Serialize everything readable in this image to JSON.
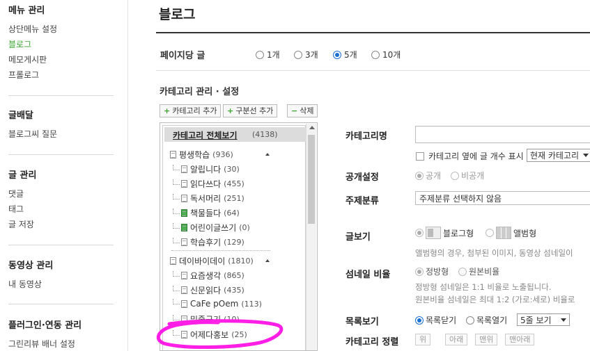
{
  "sidebar": {
    "sections": [
      {
        "title": "메뉴 관리",
        "items": [
          "상단메뉴 설정",
          "블로그",
          "메모게시판",
          "프롤로그"
        ],
        "active": 1
      },
      {
        "title": "글배달",
        "items": [
          "블로그씨 질문"
        ]
      },
      {
        "title": "글 관리",
        "items": [
          "댓글",
          "태그",
          "글 저장"
        ]
      },
      {
        "title": "동영상 관리",
        "items": [
          "내 동영상"
        ]
      },
      {
        "title": "플러그인·연동 관리",
        "items": [
          "그린리뷰 배너 설정"
        ]
      }
    ]
  },
  "main": {
    "title": "블로그",
    "per_page": {
      "label": "페이지당 글",
      "options": [
        "1개",
        "3개",
        "5개",
        "10개"
      ],
      "selected": "5개"
    },
    "category": {
      "title": "카테고리 관리 · 설정",
      "buttons": {
        "add_category": "카테고리 추가",
        "add_divider": "구분선 추가",
        "delete": "삭제"
      },
      "tree": {
        "root": {
          "label": "카테고리 전체보기",
          "count": "(4138)"
        },
        "nodes": [
          {
            "label": "평생학습",
            "count": "(936)",
            "level": 0
          },
          {
            "label": "알립니다",
            "count": "(30)",
            "level": 1
          },
          {
            "label": "읽다쓰다",
            "count": "(455)",
            "level": 1
          },
          {
            "label": "독서머리",
            "count": "(251)",
            "level": 1
          },
          {
            "label": "책물들다",
            "count": "(64)",
            "level": 1,
            "green": true
          },
          {
            "label": "어린이글쓰기",
            "count": "(0)",
            "level": 1,
            "green": true
          },
          {
            "label": "학습후기",
            "count": "(129)",
            "level": 1
          },
          {
            "label": "데이바이데이",
            "count": "(1810)",
            "level": 0
          },
          {
            "label": "요즘생각",
            "count": "(865)",
            "level": 1
          },
          {
            "label": "신문읽다",
            "count": "(435)",
            "level": 1
          },
          {
            "label": "CaFe pOem",
            "count": "(113)",
            "level": 1
          },
          {
            "label": "밑줄긋기",
            "count": "(10)",
            "level": 1
          },
          {
            "label": "어제다홍보",
            "count": "(25)",
            "level": 1
          }
        ]
      }
    },
    "form": {
      "category_name": {
        "label": "카테고리명",
        "value": ""
      },
      "show_count": {
        "label": "카테고리 옆에 글 개수 표시",
        "select": "현재 카테고리"
      },
      "visibility": {
        "label": "공개설정",
        "options": [
          "공개",
          "비공개"
        ],
        "selected": "공개"
      },
      "topic": {
        "label": "주제분류",
        "value": "주제분류 선택하지 않음"
      },
      "view": {
        "label": "글보기",
        "options": [
          "블로그형",
          "앨범형"
        ],
        "selected": "블로그형",
        "note": "앨범형의 경우, 첨부된 이미지, 동영상 섬네일이"
      },
      "thumb_ratio": {
        "label": "섬네일 비율",
        "options": [
          "정방형",
          "원본비율"
        ],
        "selected": "정방형",
        "notes": [
          "정방형 섬네일은 1:1 비율로 노출됩니다.",
          "원본비율 섬네일은 최대 1:2 (가로:세로) 비율로"
        ]
      },
      "list_view": {
        "label": "목록보기",
        "options": [
          "목록닫기",
          "목록열기"
        ],
        "selected": "목록닫기",
        "select": "5줄 보기"
      },
      "sort": {
        "label": "카테고리 정렬",
        "buttons": [
          "위",
          "아래",
          "맨위",
          "맨아래"
        ]
      }
    }
  },
  "colors": {
    "accent_green": "#3aa530",
    "radio_blue": "#1a6fd1",
    "annotation_magenta": "#ff1ee6"
  }
}
